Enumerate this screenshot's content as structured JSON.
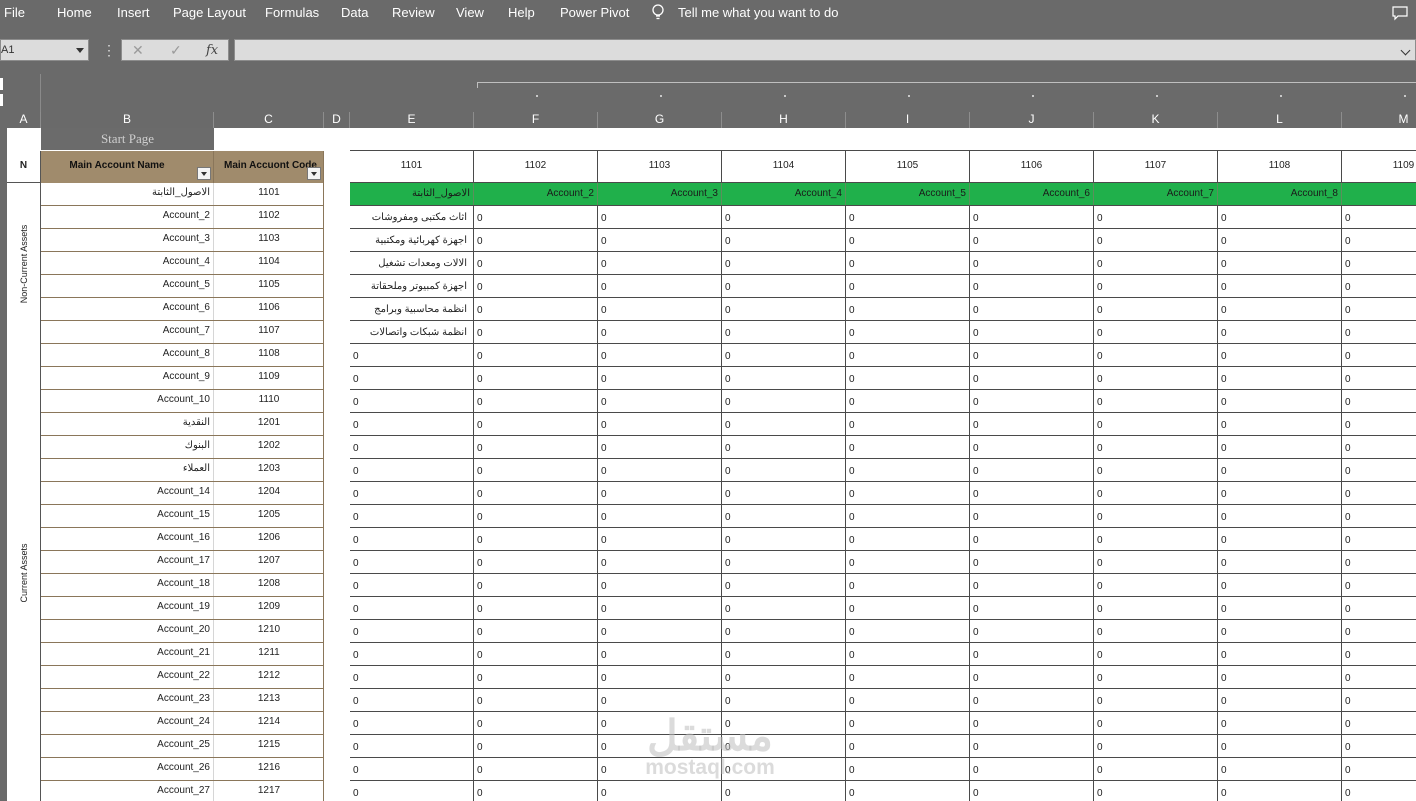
{
  "ribbon": {
    "tabs": [
      "File",
      "Home",
      "Insert",
      "Page Layout",
      "Formulas",
      "Data",
      "Review",
      "View",
      "Help",
      "Power Pivot"
    ],
    "tell_me": "Tell me what you want to do"
  },
  "formula_bar": {
    "name_box": "A1",
    "cancel_glyph": "✕",
    "enter_glyph": "✓",
    "fx_label": "fx",
    "formula": ""
  },
  "columns": [
    "A",
    "B",
    "C",
    "D",
    "E",
    "F",
    "G",
    "H",
    "I",
    "J",
    "K",
    "L",
    "M"
  ],
  "sheet": {
    "start_page_button": "Start Page",
    "n_label": "N",
    "headers": {
      "name": "Main Account Name",
      "code": "Main Accuont Code"
    },
    "groups": [
      "Non-Current Assets",
      "Current Assets"
    ],
    "accounts": [
      {
        "name": "الاصول_الثابتة",
        "code": "1101"
      },
      {
        "name": "Account_2",
        "code": "1102"
      },
      {
        "name": "Account_3",
        "code": "1103"
      },
      {
        "name": "Account_4",
        "code": "1104"
      },
      {
        "name": "Account_5",
        "code": "1105"
      },
      {
        "name": "Account_6",
        "code": "1106"
      },
      {
        "name": "Account_7",
        "code": "1107"
      },
      {
        "name": "Account_8",
        "code": "1108"
      },
      {
        "name": "Account_9",
        "code": "1109"
      },
      {
        "name": "Account_10",
        "code": "1110"
      },
      {
        "name": "النقدية",
        "code": "1201"
      },
      {
        "name": "البنوك",
        "code": "1202"
      },
      {
        "name": "العملاء",
        "code": "1203"
      },
      {
        "name": "Account_14",
        "code": "1204"
      },
      {
        "name": "Account_15",
        "code": "1205"
      },
      {
        "name": "Account_16",
        "code": "1206"
      },
      {
        "name": "Account_17",
        "code": "1207"
      },
      {
        "name": "Account_18",
        "code": "1208"
      },
      {
        "name": "Account_19",
        "code": "1209"
      },
      {
        "name": "Account_20",
        "code": "1210"
      },
      {
        "name": "Account_21",
        "code": "1211"
      },
      {
        "name": "Account_22",
        "code": "1212"
      },
      {
        "name": "Account_23",
        "code": "1213"
      },
      {
        "name": "Account_24",
        "code": "1214"
      },
      {
        "name": "Account_25",
        "code": "1215"
      },
      {
        "name": "Account_26",
        "code": "1216"
      },
      {
        "name": "Account_27",
        "code": "1217"
      }
    ],
    "matrix_codes": [
      "1101",
      "1102",
      "1103",
      "1104",
      "1105",
      "1106",
      "1107",
      "1108",
      "1109"
    ],
    "matrix_names": [
      "الاصول_الثابتة",
      "Account_2",
      "Account_3",
      "Account_4",
      "Account_5",
      "Account_6",
      "Account_7",
      "Account_8",
      ""
    ],
    "sub_accounts": [
      "اثاث مكتبى ومفروشات",
      "اجهزة كهربائية ومكتبية",
      "الالات ومعدات تشغيل",
      "اجهزة كمبيوتر وملحقاتة",
      "انظمة محاسبية وبرامج",
      "انظمة شبكات واتصالات"
    ],
    "zero_value": "0",
    "green_color": "#20b04b",
    "header_color": "#a08b6c"
  },
  "watermark": {
    "arabic": "مستقل",
    "latin": "mostaql.com"
  }
}
